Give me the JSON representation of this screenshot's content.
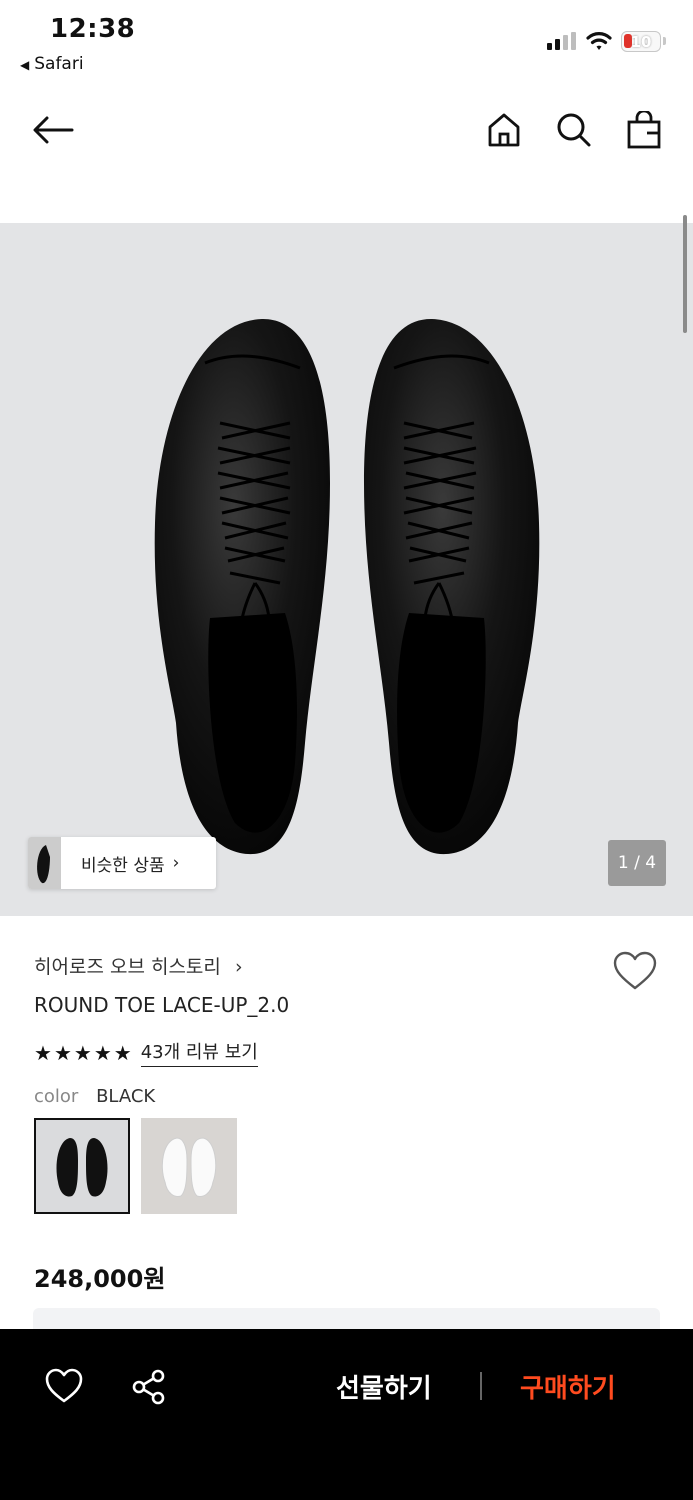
{
  "status": {
    "time": "12:38",
    "back_app": "Safari",
    "battery": "10"
  },
  "nav": {
    "back_icon": "arrow-left-icon",
    "home_icon": "home-icon",
    "search_icon": "search-icon",
    "bag_icon": "shopping-bag-icon"
  },
  "gallery": {
    "similar_label": "비슷한 상품",
    "chevron": "›",
    "counter": "1 / 4"
  },
  "product": {
    "brand": "히어로즈 오브 히스토리",
    "brand_chevron": "›",
    "name": "ROUND TOE LACE-UP_2.0",
    "rating": 5,
    "review_link": "43개 리뷰 보기",
    "color_key": "color",
    "color_value": "BLACK",
    "swatches": [
      "black",
      "white"
    ],
    "price": "248,000원"
  },
  "bottom": {
    "gift": "선물하기",
    "buy": "구매하기"
  },
  "colors": {
    "accent": "#ff4b1f",
    "bar_bg": "#000000",
    "image_bg": "#e3e4e6"
  }
}
